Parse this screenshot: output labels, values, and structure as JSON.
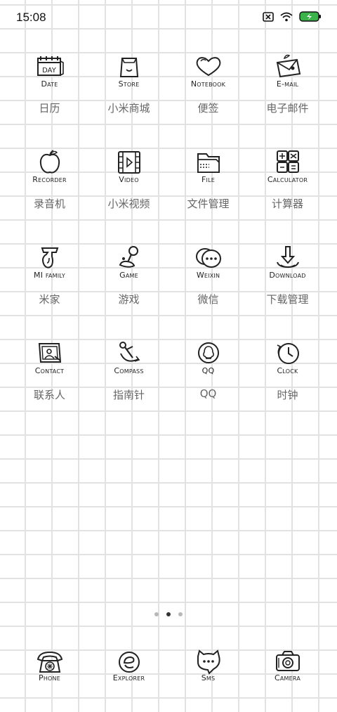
{
  "status": {
    "time": "15:08"
  },
  "apps": [
    [
      {
        "en": "Date",
        "zh": "日历"
      },
      {
        "en": "Store",
        "zh": "小米商城"
      },
      {
        "en": "Notebook",
        "zh": "便签"
      },
      {
        "en": "E-mail",
        "zh": "电子邮件"
      }
    ],
    [
      {
        "en": "Recorder",
        "zh": "录音机"
      },
      {
        "en": "Video",
        "zh": "小米视频"
      },
      {
        "en": "File",
        "zh": "文件管理"
      },
      {
        "en": "Calculator",
        "zh": "计算器"
      }
    ],
    [
      {
        "en": "MI family",
        "zh": "米家"
      },
      {
        "en": "Game",
        "zh": "游戏"
      },
      {
        "en": "Weixin",
        "zh": "微信"
      },
      {
        "en": "Download",
        "zh": "下载管理"
      }
    ],
    [
      {
        "en": "Contact",
        "zh": "联系人"
      },
      {
        "en": "Compass",
        "zh": "指南针"
      },
      {
        "en": "QQ",
        "zh": "QQ"
      },
      {
        "en": "Clock",
        "zh": "时钟"
      }
    ]
  ],
  "date_icon_text": "DAY",
  "pager": {
    "count": 3,
    "active": 1
  },
  "dock": [
    {
      "en": "Phone"
    },
    {
      "en": "Explorer"
    },
    {
      "en": "Sms"
    },
    {
      "en": "Camera"
    }
  ],
  "colors": {
    "battery": "#3bb34a",
    "grid": "#e2e2e2"
  }
}
